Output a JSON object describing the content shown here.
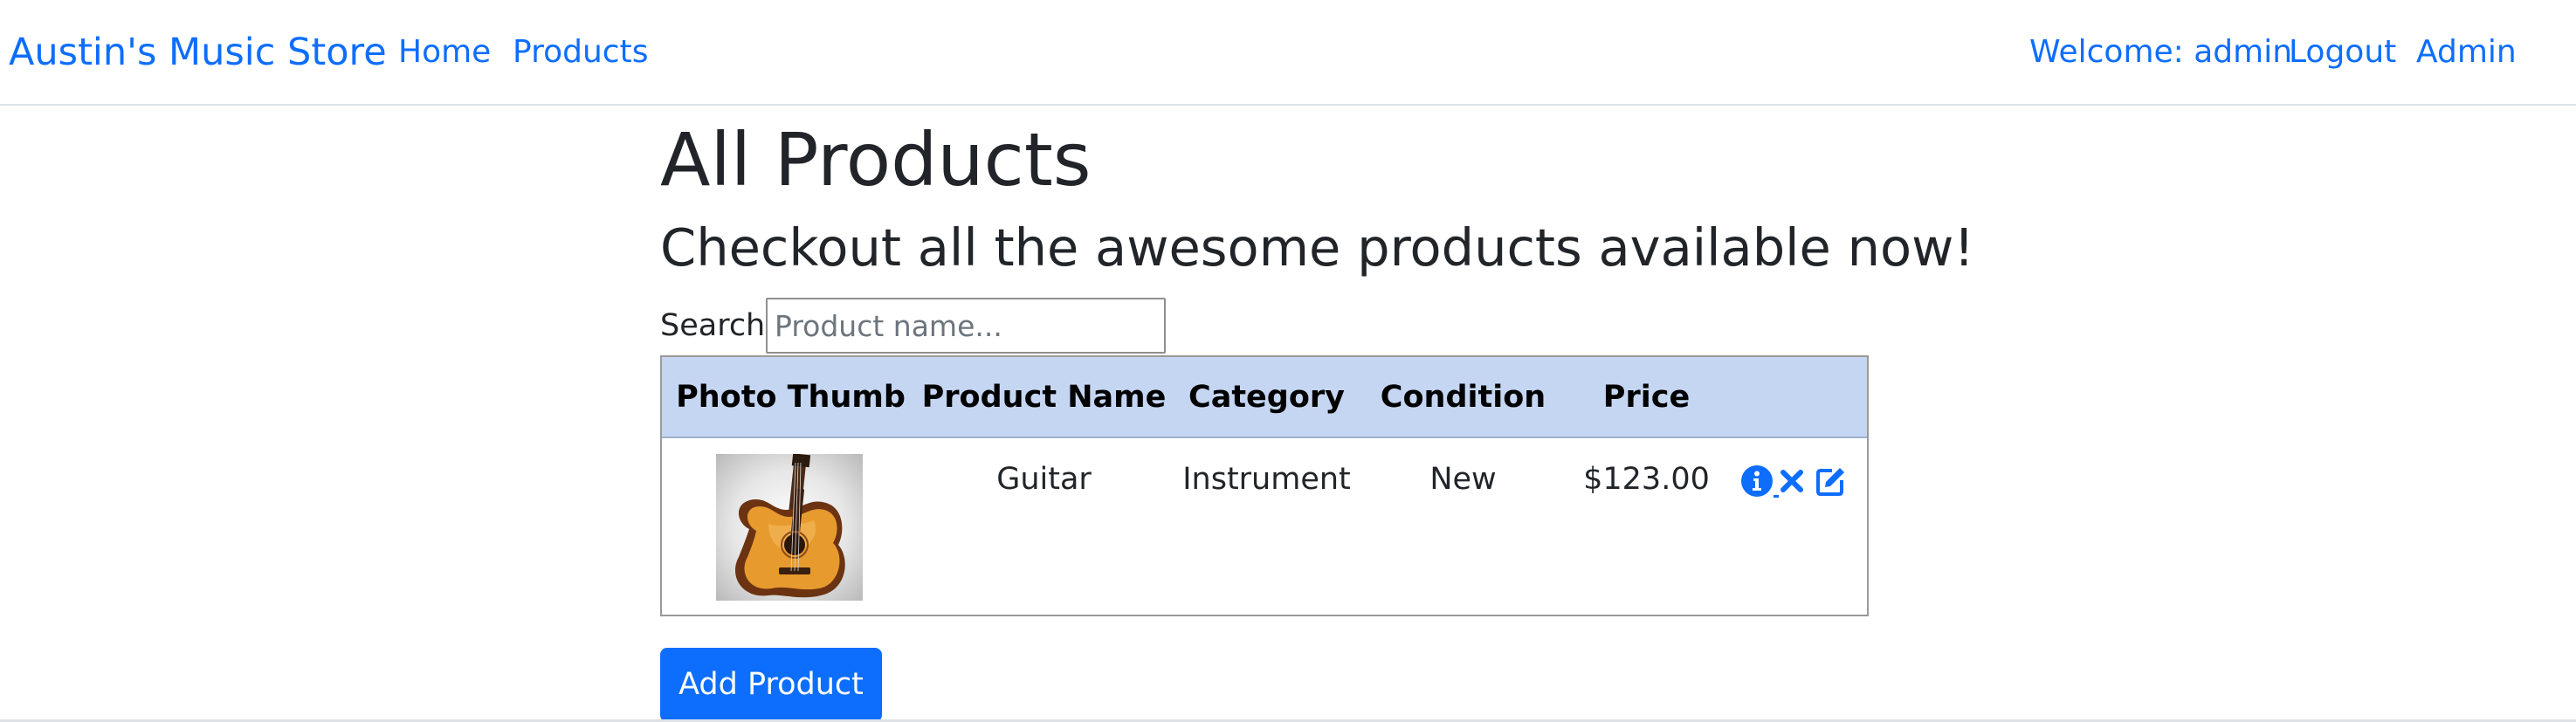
{
  "navbar": {
    "brand": "Austin's Music Store",
    "links": {
      "home": "Home",
      "products": "Products"
    },
    "right": {
      "welcome": "Welcome: admin",
      "logout": "Logout",
      "admin": "Admin"
    }
  },
  "page": {
    "title": "All Products",
    "subtitle": "Checkout all the awesome products available now!"
  },
  "search": {
    "label": "Search:",
    "placeholder": "Product name...",
    "value": ""
  },
  "table": {
    "headers": {
      "thumb": "Photo Thumb",
      "name": "Product Name",
      "category": "Category",
      "condition": "Condition",
      "price": "Price",
      "actions": ""
    },
    "rows": [
      {
        "thumb_icon": "guitar-photo",
        "name": "Guitar",
        "category": "Instrument",
        "condition": "New",
        "price": "$123.00",
        "action_icons": [
          "info-icon",
          "delete-icon",
          "edit-icon"
        ]
      }
    ]
  },
  "add_button": {
    "label": "Add Product"
  },
  "colors": {
    "link": "#0d6efd",
    "header_bg": "#c5d6f3",
    "button_bg": "#0d6efd",
    "text": "#212529"
  }
}
